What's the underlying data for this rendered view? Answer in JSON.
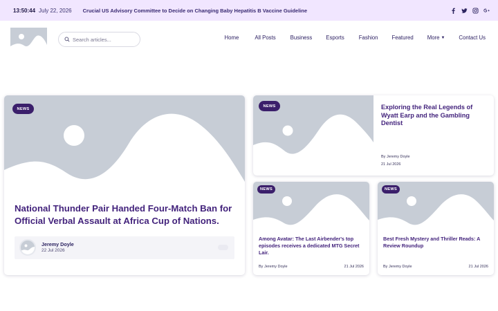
{
  "topbar": {
    "time": "13:50:44",
    "date": "July 22, 2026",
    "ticker": "Crucial US Advisory Committee to Decide on Changing Baby Hepatitis B Vaccine Guideline",
    "social": [
      "facebook-icon",
      "twitter-icon",
      "instagram-icon",
      "google-plus-icon"
    ]
  },
  "header": {
    "search_placeholder": "Search articles...",
    "nav": [
      "Home",
      "All Posts",
      "Business",
      "Esports",
      "Fashion",
      "Featured",
      "More",
      "Contact Us"
    ]
  },
  "featured": {
    "badge": "NEWS",
    "title": "National Thunder Pair Handed Four-Match Ban for Official Verbal Assault at Africa Cup of Nations.",
    "author": "Jeremy Doyle",
    "date": "22 Jul 2026"
  },
  "side_top": {
    "badge": "NEWS",
    "title": "Exploring the Real Legends of Wyatt Earp and the Gambling Dentist",
    "byline": "By Jeremy Doyle",
    "date": "21 Jul 2026"
  },
  "small_cards": [
    {
      "badge": "NEWS",
      "title": "Among Avatar: The Last Airbender's top episodes receives a dedicated MTG Secret Lair.",
      "byline": "By Jeremy Doyle",
      "date": "21 Jul 2026"
    },
    {
      "badge": "NEWS",
      "title": "Best Fresh Mystery and Thriller Reads: A Review Roundup",
      "byline": "By Jeremy Doyle",
      "date": "21 Jul 2026"
    }
  ],
  "colors": {
    "topbar_bg": "#f1e6ff",
    "accent": "#43237c",
    "badge_bg": "#3b1f6b",
    "placeholder": "#c7cdd6"
  }
}
